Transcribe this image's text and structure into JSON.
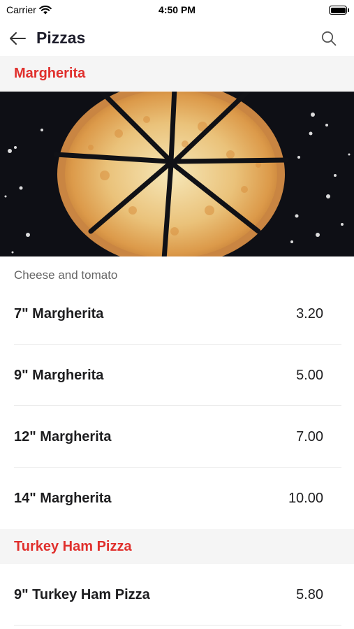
{
  "status_bar": {
    "carrier": "Carrier",
    "time": "4:50 PM"
  },
  "nav": {
    "title": "Pizzas",
    "back_icon": "arrow-left-icon",
    "search_icon": "search-icon"
  },
  "sections": [
    {
      "title": "Margherita",
      "image": "pizza-photo",
      "description": "Cheese and tomato",
      "items": [
        {
          "name": "7\" Margherita",
          "price": "3.20"
        },
        {
          "name": "9\" Margherita",
          "price": "5.00"
        },
        {
          "name": "12\" Margherita",
          "price": "7.00"
        },
        {
          "name": "14\" Margherita",
          "price": "10.00"
        }
      ]
    },
    {
      "title": "Turkey Ham Pizza",
      "items": [
        {
          "name": "9\" Turkey Ham Pizza",
          "price": "5.80"
        }
      ]
    }
  ],
  "colors": {
    "accent": "#e0302d",
    "section_bg": "#f5f5f5",
    "text": "#1d1d1f",
    "muted": "#666666"
  }
}
